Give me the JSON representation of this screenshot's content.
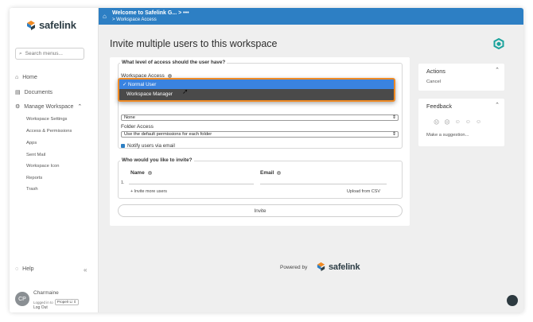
{
  "brand": {
    "name": "safelink",
    "colors": {
      "primary": "#2d7fc4",
      "accent": "#f08a24",
      "dark": "#2d3d45"
    }
  },
  "sidebar": {
    "search_placeholder": "Search menus...",
    "home": "Home",
    "documents": "Documents",
    "manage_workspace": "Manage Workspace",
    "sub_items": [
      "Workspace Settings",
      "Access & Permissions",
      "Apps",
      "Sent Mail",
      "Workspace Icon",
      "Reports",
      "Trash"
    ],
    "help": "Help",
    "user": {
      "initials": "CP",
      "name": "Charmaine",
      "logged_in_label": "Logged in to",
      "org": "Propelr Li",
      "logout": "Log Out"
    }
  },
  "topbar": {
    "title": "Welcome to Safelink G...",
    "separator": ">",
    "more": "•••",
    "breadcrumb": "> Workspace Access"
  },
  "main": {
    "title": "Invite multiple users to this workspace",
    "access_section": {
      "legend": "What level of access should the user have?",
      "workspace_access_label": "Workspace Access",
      "dropdown_options": [
        "Normal User",
        "Workspace Manager"
      ],
      "selected_option": "Normal User",
      "second_select_value": "None",
      "folder_access_label": "Folder Access",
      "folder_access_value": "Use the default permissions for each folder",
      "notify_label": "Notify users via email"
    },
    "invite_section": {
      "legend": "Who would you like to invite?",
      "name_header": "Name",
      "email_header": "Email",
      "row_number": "1.",
      "add_more": "+ Invite more users",
      "upload_csv": "Upload from CSV"
    },
    "invite_button": "Invite",
    "powered_by": "Powered by"
  },
  "right_panels": {
    "actions": {
      "title": "Actions",
      "cancel": "Cancel"
    },
    "feedback": {
      "title": "Feedback",
      "suggestion": "Make a suggestion..."
    }
  }
}
